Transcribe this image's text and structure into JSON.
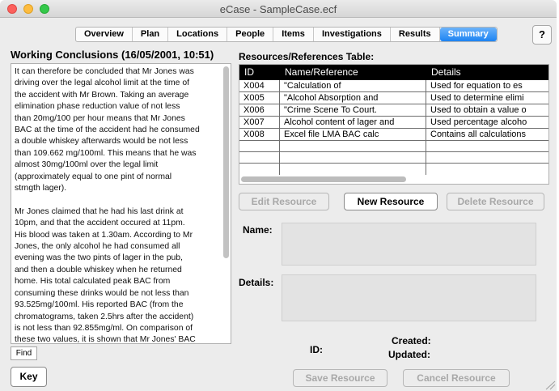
{
  "window": {
    "title": "eCase - SampleCase.ecf"
  },
  "tabs": [
    "Overview",
    "Plan",
    "Locations",
    "People",
    "Items",
    "Investigations",
    "Results",
    "Summary"
  ],
  "active_tab": "Summary",
  "help_label": "?",
  "conclusions": {
    "heading": "Working Conclusions (16/05/2001, 10:51)",
    "lines": [
      "It can therefore be concluded that Mr Jones was",
      "driving over the legal alcohol limit at the time of",
      "the accident with Mr Brown.  Taking an average",
      "elimination phase reduction value of not less",
      "than 20mg/100 per hour means that Mr Jones",
      "BAC at the time of the accident had he consumed",
      "a double whiskey afterwards would be not less",
      "than 109.662 mg/100ml.  This means that he was",
      "almost 30mg/100ml over the legal limit",
      "(approximately equal to one pint of normal",
      "strngth lager).",
      "",
      "Mr Jones claimed that he had his last drink at",
      "10pm, and that the accident occured at 11pm.",
      "His blood was taken at 1.30am.  According to Mr",
      "Jones, the only alcohol he had consumed all",
      "evening was the two pints of lager in the pub,",
      "and then a double whiskey when he returned",
      "home.  His total calculated peak BAC from",
      "consuming these drinks would be not less than",
      "93.525mg/100ml.  His reported  BAC (from the",
      "chromatograms, taken 2.5hrs after the accident)",
      "is not less than 92.855mg/ml.  On comparison of",
      "these two values, it is shown that Mr Jones' BAC"
    ]
  },
  "find_label": "Find",
  "key_label": "Key",
  "resources": {
    "heading": "Resources/References Table:",
    "columns": [
      "ID",
      "Name/Reference",
      "Details"
    ],
    "rows": [
      [
        "X004",
        "\"Calculation of",
        "Used for equation to es"
      ],
      [
        "X005",
        "\"Alcohol Absorption and",
        "Used to determine elimi"
      ],
      [
        "X006",
        "\"Crime Scene To Court.",
        "Used to obtain a value o"
      ],
      [
        "X007",
        "Alcohol content of lager and",
        "Used percentage alcoho"
      ],
      [
        "X008",
        "Excel file LMA BAC calc",
        "Contains all calculations"
      ]
    ]
  },
  "buttons": {
    "edit": "Edit Resource",
    "new": "New Resource",
    "delete": "Delete Resource",
    "save": "Save Resource",
    "cancel": "Cancel Resource"
  },
  "form": {
    "name_label": "Name:",
    "details_label": "Details:",
    "id_label": "ID:",
    "created_label": "Created:",
    "updated_label": "Updated:"
  }
}
